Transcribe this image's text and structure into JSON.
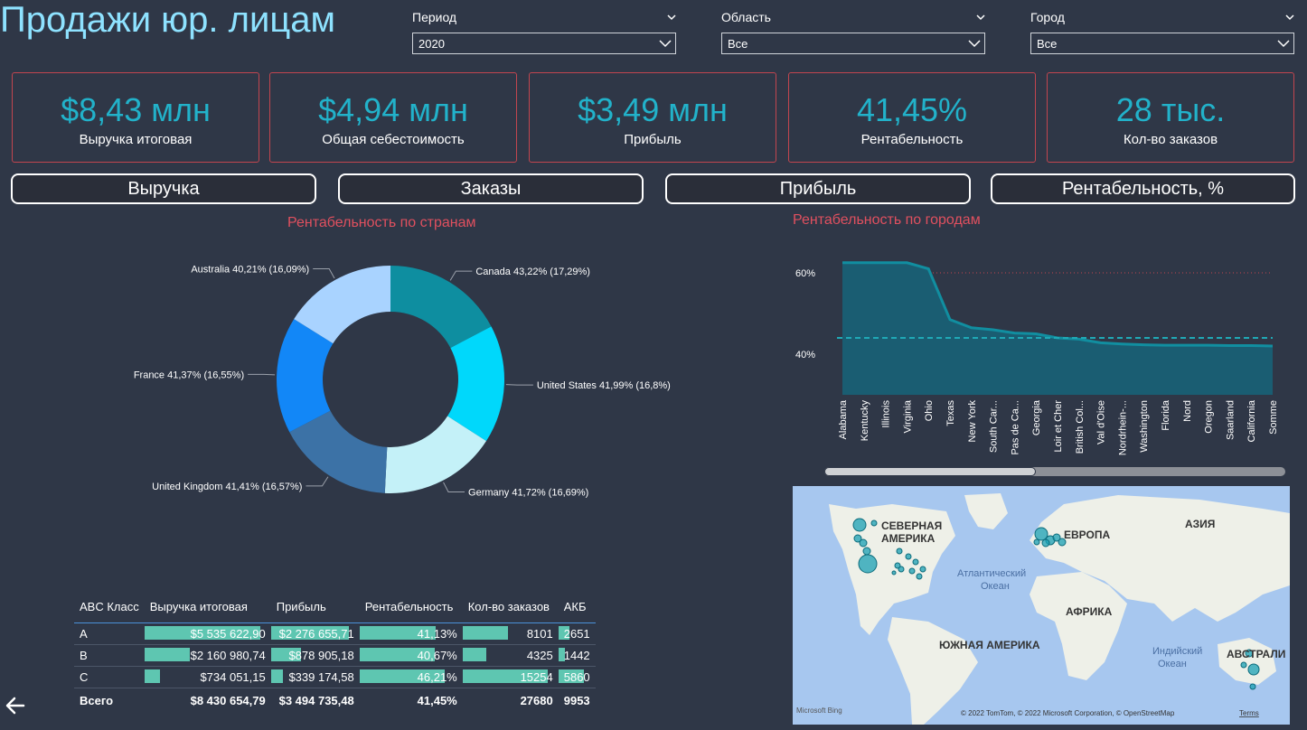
{
  "title": "Продажи юр. лицам",
  "slicers": [
    {
      "label": "Период",
      "value": "2020"
    },
    {
      "label": "Область",
      "value": "Все"
    },
    {
      "label": "Город",
      "value": "Все"
    }
  ],
  "kpis": [
    {
      "value": "$8,43 млн",
      "label": "Выручка итоговая"
    },
    {
      "value": "$4,94 млн",
      "label": "Общая себестоимость"
    },
    {
      "value": "$3,49 млн",
      "label": "Прибыль"
    },
    {
      "value": "41,45%",
      "label": "Рентабельность"
    },
    {
      "value": "28 тыс.",
      "label": "Кол-во заказов"
    }
  ],
  "nav_buttons": [
    "Выручка",
    "Заказы",
    "Прибыль",
    "Рентабельность, %"
  ],
  "donut": {
    "title": "Рентабельность по странам",
    "chart_data": {
      "type": "pie",
      "categories": [
        "Canada",
        "United States",
        "Germany",
        "United Kingdom",
        "France",
        "Australia"
      ],
      "values": [
        17.29,
        16.8,
        16.69,
        16.57,
        16.55,
        16.09
      ],
      "labels": [
        "Canada 43,22% (17,29%)",
        "United States 41,99% (16,8%)",
        "Germany 41,72% (16,69%)",
        "United Kingdom 41,41% (16,57%)",
        "France 41,37% (16,55%)",
        "Australia 40,21% (16,09%)"
      ],
      "colors": [
        "#0e8ea0",
        "#00d8fb",
        "#c4f1f8",
        "#3c72a6",
        "#1287f7",
        "#a9d3ff"
      ]
    }
  },
  "linechart": {
    "title": "Рентабельность по городам",
    "chart_data": {
      "type": "area",
      "categories": [
        "Alabama",
        "Kentucky",
        "Illinois",
        "Virginia",
        "Ohio",
        "Texas",
        "New York",
        "South Car...",
        "Pas de Ca...",
        "Georgia",
        "Loir et Cher",
        "British Col...",
        "Val d'Oise",
        "Nordrhein-...",
        "Washington",
        "Florida",
        "Nord",
        "Oregon",
        "Saarland",
        "California",
        "Somme"
      ],
      "values": [
        62.5,
        62.5,
        62.5,
        62.5,
        61,
        48.5,
        46.5,
        46,
        45.2,
        45,
        44,
        43.7,
        42.8,
        42.5,
        42.3,
        42.2,
        42.2,
        42.2,
        42.1,
        42.1,
        42
      ],
      "average": 44,
      "yticks": [
        "60%",
        "40%"
      ],
      "ytick_values": [
        60,
        40
      ],
      "ylim": [
        30,
        66
      ],
      "color": "#118ea0"
    }
  },
  "map": {
    "labels": [
      "СЕВЕРНАЯ",
      "АМЕРИКА",
      "ЕВРОПА",
      "АЗИЯ",
      "АФРИКА",
      "ЮЖНАЯ АМЕРИКА",
      "АВСТРАЛИ",
      "Атлантический",
      "Океан",
      "Индийский",
      "Океан"
    ],
    "attribution": "© 2022 TomTom, © 2022 Microsoft Corporation, © OpenStreetMap",
    "terms": "Terms",
    "bing": "Microsoft Bing"
  },
  "table": {
    "headers": [
      "ABC Класс",
      "Выручка итоговая",
      "Прибыль",
      "Рентабельность",
      "Кол-во заказов",
      "АКБ"
    ],
    "rows": [
      {
        "cls": "A",
        "rev": "$5 535 622,90",
        "rev_v": 5535622.9,
        "profit": "$2 276 655,71",
        "profit_v": 2276655.71,
        "margin": "41,13%",
        "margin_v": 41.13,
        "orders": "8101",
        "orders_v": 8101,
        "akb": "2651",
        "akb_v": 2651
      },
      {
        "cls": "B",
        "rev": "$2 160 980,74",
        "rev_v": 2160980.74,
        "profit": "$878 905,18",
        "profit_v": 878905.18,
        "margin": "40,67%",
        "margin_v": 40.67,
        "orders": "4325",
        "orders_v": 4325,
        "akb": "1442",
        "akb_v": 1442
      },
      {
        "cls": "C",
        "rev": "$734 051,15",
        "rev_v": 734051.15,
        "profit": "$339 174,58",
        "profit_v": 339174.58,
        "margin": "46,21%",
        "margin_v": 46.21,
        "orders": "15254",
        "orders_v": 15254,
        "akb": "5860",
        "akb_v": 5860
      }
    ],
    "total": {
      "cls": "Всего",
      "rev": "$8 430 654,79",
      "profit": "$3 494 735,48",
      "margin": "41,45%",
      "orders": "27680",
      "akb": "9953"
    }
  }
}
